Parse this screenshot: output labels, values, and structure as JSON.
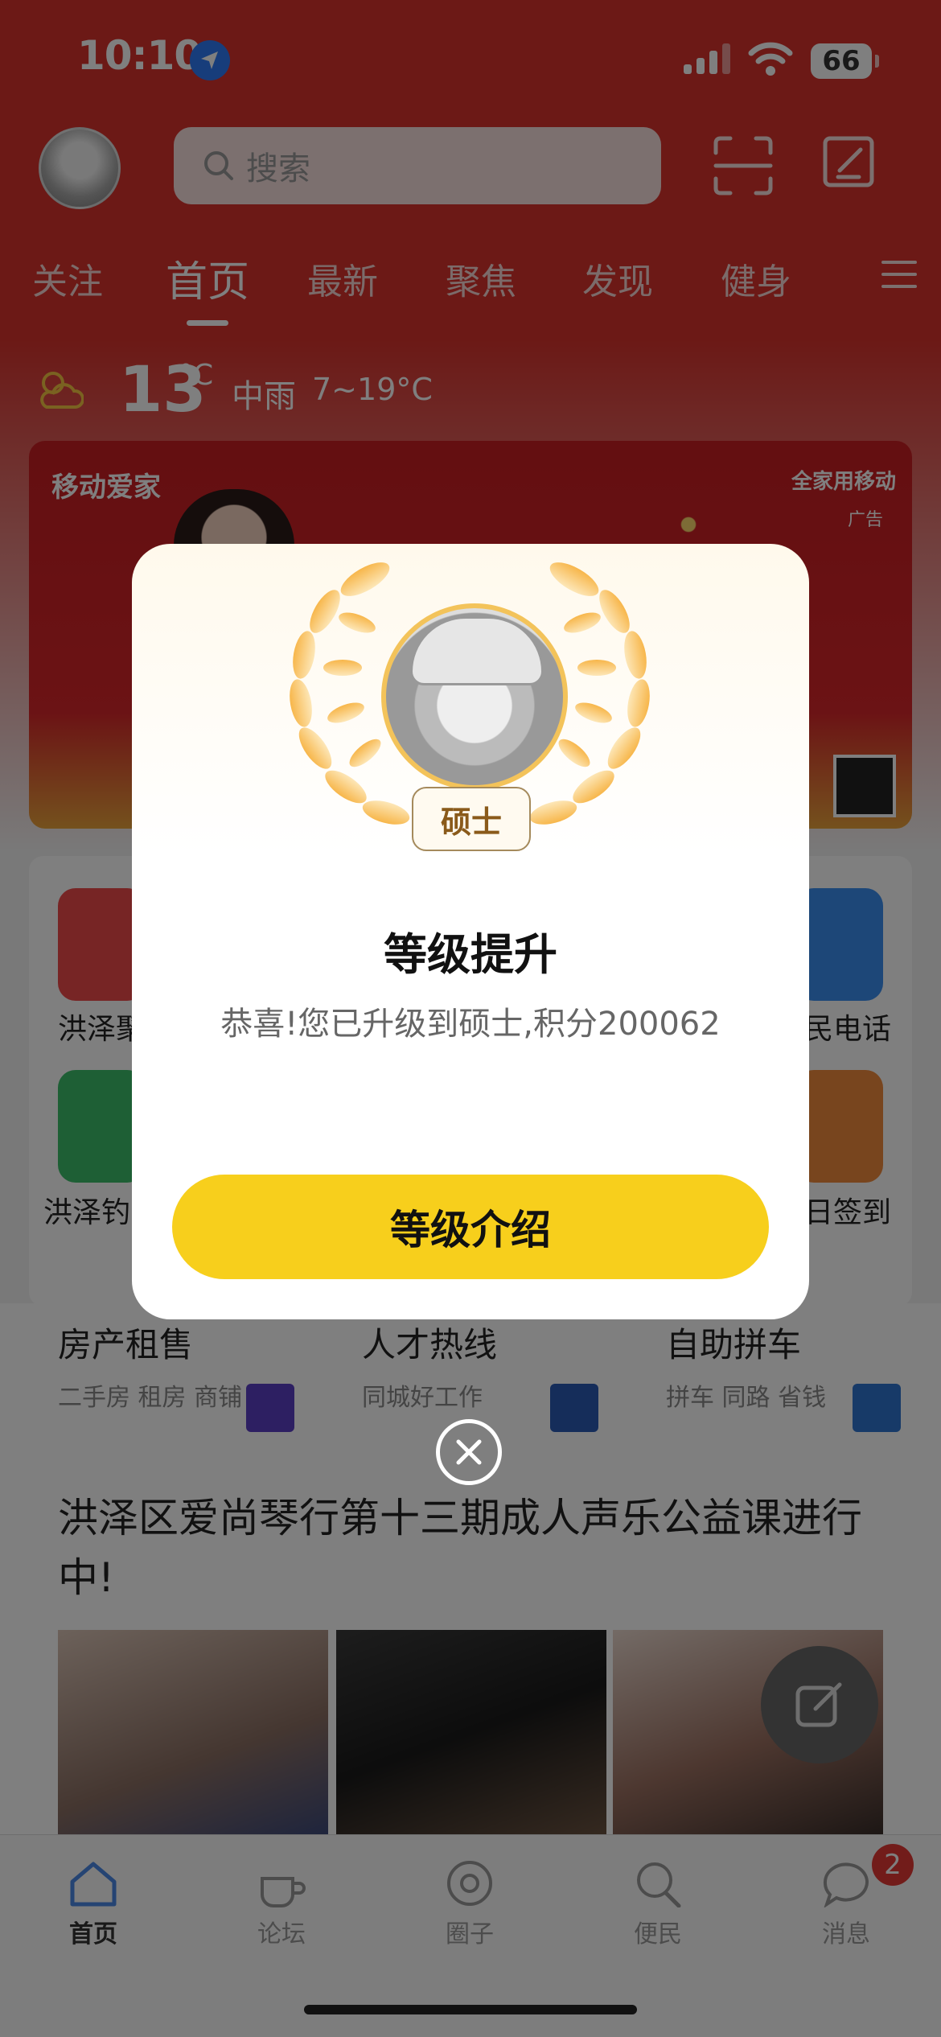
{
  "status_bar": {
    "time": "10:10",
    "battery": "66"
  },
  "header": {
    "search_placeholder": "搜索",
    "tabs": [
      "关注",
      "首页",
      "最新",
      "聚焦",
      "发现",
      "健身"
    ],
    "active_tab": "首页"
  },
  "weather": {
    "temp": "13",
    "unit": "°C",
    "condition": "中雨",
    "range": "7~19°C"
  },
  "banner": {
    "brand": "移动爱家",
    "corner_text": "全家用移动",
    "ad_label": "广告"
  },
  "grid": {
    "items": [
      {
        "label": "洪泽聚",
        "color": "#ef4b4b"
      },
      {
        "label": "民电话",
        "color": "#3a8ff0"
      },
      {
        "label": "洪泽钓",
        "color": "#3cbf6b"
      },
      {
        "label": "日签到",
        "color": "#f08a3c"
      }
    ]
  },
  "services": [
    {
      "title": "房产租售",
      "subtitle": "二手房 租房 商铺"
    },
    {
      "title": "人才热线",
      "subtitle": "同城好工作"
    },
    {
      "title": "自助拼车",
      "subtitle": "拼车  同路  省钱"
    }
  ],
  "article": {
    "title": "洪泽区爱尚琴行第十三期成人声乐公益课进行中!"
  },
  "bottom_nav": {
    "items": [
      "首页",
      "论坛",
      "圈子",
      "便民",
      "消息"
    ],
    "active": "首页",
    "message_badge": "2"
  },
  "modal": {
    "level": "硕士",
    "title": "等级提升",
    "message": "恭喜!您已升级到硕士,积分200062",
    "button": "等级介绍"
  },
  "colors": {
    "header_red": "#d8322c",
    "button_yellow": "#f7cf1c",
    "laurel_gold": "#f7c267"
  }
}
